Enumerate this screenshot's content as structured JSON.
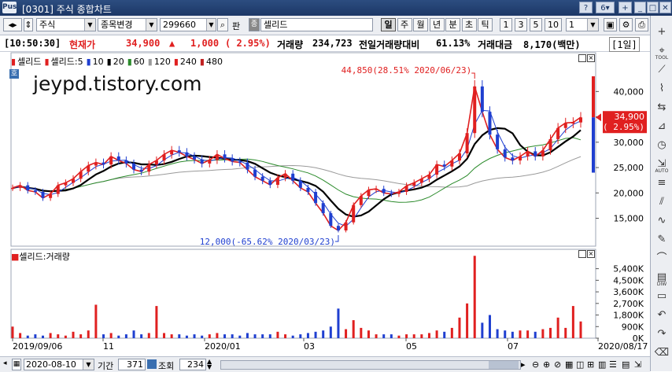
{
  "window": {
    "code": "[0301]",
    "title": "주식 종합차트",
    "tab_number": "6"
  },
  "toolbar": {
    "market": "주식",
    "search_button": "종목변경",
    "stock_code": "299660",
    "pan_label": "판",
    "badge": "종",
    "stock_name": "셀리드",
    "periods": [
      "일",
      "주",
      "월",
      "년",
      "분",
      "초",
      "틱"
    ],
    "selected_period": "일",
    "intervals": [
      "1",
      "3",
      "5",
      "10"
    ],
    "interval_value": "1"
  },
  "quote": {
    "time": "[10:50:30]",
    "label": "현재가",
    "price": "34,900",
    "arrow": "▲",
    "change": "1,000",
    "change_pct": "( 2.95%)",
    "volume_label": "거래량",
    "volume": "234,723",
    "prev_vol_label": "전일거래량대비",
    "prev_vol_pct": "61.13%",
    "amount_label": "거래대금",
    "amount": "8,170(백만)",
    "period_tag": "[1일]"
  },
  "legend": [
    {
      "text": "셀리드",
      "color": "#e02020"
    },
    {
      "text": "셀리드:5",
      "color": "#e02020"
    },
    {
      "text": "10",
      "color": "#1f3fd0"
    },
    {
      "text": "20",
      "color": "#000000"
    },
    {
      "text": "60",
      "color": "#2a8a2a"
    },
    {
      "text": "120",
      "color": "#9a9a9a"
    },
    {
      "text": "240",
      "color": "#e02020"
    },
    {
      "text": "480",
      "color": "#c02020"
    }
  ],
  "watermark": "jeypd.tistory.com",
  "chart_data": {
    "type": "candlestick",
    "price_ticks": [
      "40,000",
      "35,000",
      "30,000",
      "25,000",
      "20,000",
      "15,000"
    ],
    "price_tick_values": [
      40000,
      35000,
      30000,
      25000,
      20000,
      15000
    ],
    "ylim": [
      9500,
      47500
    ],
    "current_price": "34,900",
    "current_change": "( 2.95%)",
    "high_annotation": "44,850(28.51% 2020/06/23)",
    "low_annotation": "12,000(-65.62% 2020/03/23)",
    "dates": [
      "2019/09/06",
      "11",
      "2020/01",
      "03",
      "05",
      "07",
      "2020/08/17"
    ],
    "close_series": [
      21000,
      21500,
      20500,
      20200,
      19000,
      19800,
      21500,
      22000,
      22800,
      24200,
      25400,
      26000,
      25600,
      27200,
      26400,
      25800,
      24600,
      24200,
      25600,
      26400,
      27600,
      28400,
      28000,
      27200,
      26600,
      25800,
      26500,
      27600,
      26800,
      26200,
      26000,
      24600,
      23200,
      22400,
      21600,
      23000,
      23800,
      22400,
      21000,
      20200,
      18000,
      16000,
      13500,
      12600,
      14200,
      17600,
      19400,
      20600,
      20800,
      20000,
      19800,
      20200,
      21400,
      22000,
      22800,
      23600,
      25600,
      25200,
      26400,
      27800,
      31800,
      41000,
      36000,
      31500,
      28600,
      27000,
      26400,
      27200,
      28200,
      27200,
      28400,
      30600,
      32800,
      33800,
      33900,
      34900
    ],
    "volume_label": "셀리드:거래량",
    "volume_ticks": [
      "5,400K",
      "4,500K",
      "3,600K",
      "2,700K",
      "1,800K",
      "900K",
      "0K"
    ],
    "volume_tick_values": [
      5400,
      4500,
      3600,
      2700,
      1800,
      900,
      0
    ],
    "volume_series": [
      900,
      400,
      200,
      300,
      200,
      400,
      300,
      200,
      500,
      300,
      600,
      2600,
      300,
      400,
      200,
      300,
      600,
      300,
      400,
      2500,
      400,
      300,
      300,
      200,
      300,
      200,
      300,
      400,
      300,
      300,
      200,
      400,
      300,
      300,
      300,
      500,
      300,
      200,
      300,
      400,
      500,
      600,
      900,
      2300,
      700,
      1400,
      800,
      600,
      300,
      300,
      300,
      200,
      300,
      300,
      300,
      400,
      600,
      500,
      800,
      1600,
      2700,
      6400,
      1200,
      1800,
      700,
      600,
      500,
      600,
      600,
      500,
      700,
      800,
      1600,
      800,
      2500,
      1300
    ]
  },
  "bottom": {
    "date_value": "2020-08-10",
    "period_label": "기간",
    "period_value": "371",
    "query_label": "조회",
    "query_value": "234"
  },
  "right_tools": [
    "TOOL",
    "AUTO",
    "DIW"
  ]
}
